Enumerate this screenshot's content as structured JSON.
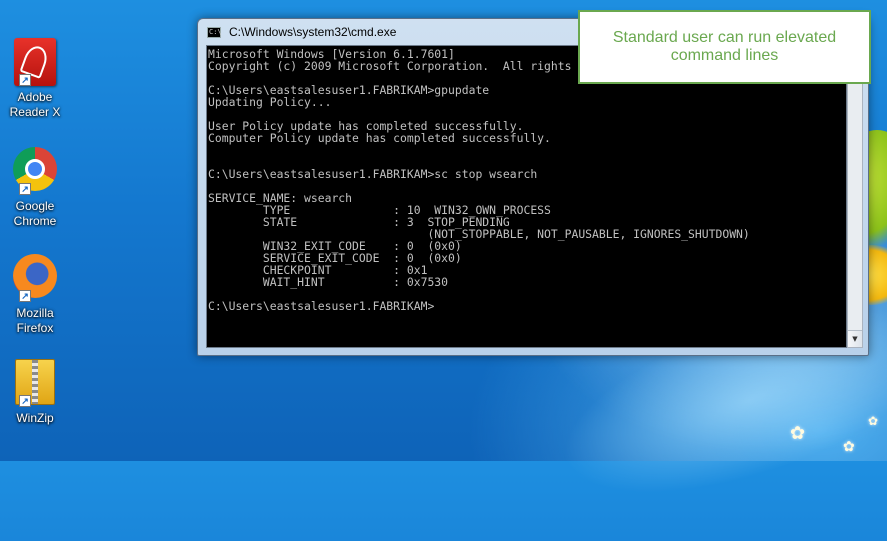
{
  "desktop": {
    "icons": [
      {
        "label_line1": "Adobe",
        "label_line2": "Reader X"
      },
      {
        "label_line1": "Google",
        "label_line2": "Chrome"
      },
      {
        "label_line1": "Mozilla",
        "label_line2": "Firefox"
      },
      {
        "label_line1": "WinZip",
        "label_line2": ""
      }
    ]
  },
  "window": {
    "title": "C:\\Windows\\system32\\cmd.exe",
    "icon_text": "C:\\"
  },
  "console": {
    "lines": [
      "Microsoft Windows [Version 6.1.7601]",
      "Copyright (c) 2009 Microsoft Corporation.  All rights reserved.",
      "",
      "C:\\Users\\eastsalesuser1.FABRIKAM>gpupdate",
      "Updating Policy...",
      "",
      "User Policy update has completed successfully.",
      "Computer Policy update has completed successfully.",
      "",
      "",
      "C:\\Users\\eastsalesuser1.FABRIKAM>sc stop wsearch",
      "",
      "SERVICE_NAME: wsearch",
      "        TYPE               : 10  WIN32_OWN_PROCESS",
      "        STATE              : 3  STOP_PENDING",
      "                                (NOT_STOPPABLE, NOT_PAUSABLE, IGNORES_SHUTDOWN)",
      "        WIN32_EXIT_CODE    : 0  (0x0)",
      "        SERVICE_EXIT_CODE  : 0  (0x0)",
      "        CHECKPOINT         : 0x1",
      "        WAIT_HINT          : 0x7530",
      "",
      "C:\\Users\\eastsalesuser1.FABRIKAM>"
    ]
  },
  "callout": {
    "line1": "Standard user can run elevated",
    "line2": "command lines"
  },
  "colors": {
    "callout_accent": "#6aa84f",
    "console_bg": "#000000",
    "console_text": "#c0c0c0"
  }
}
